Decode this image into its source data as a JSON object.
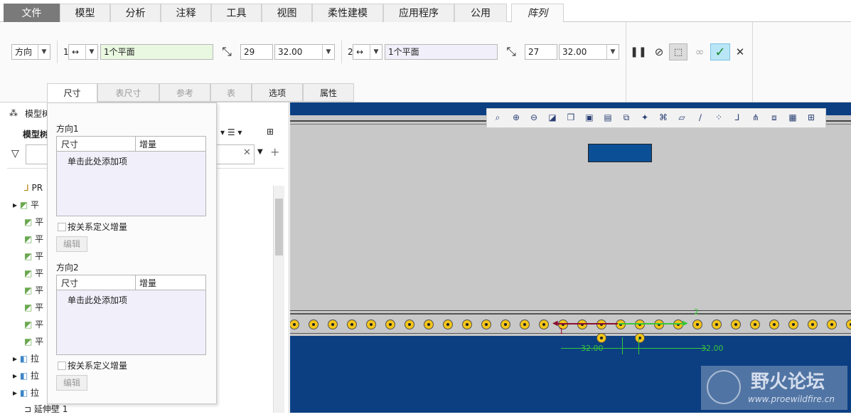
{
  "menu_tabs": [
    "文件",
    "模型",
    "分析",
    "注释",
    "工具",
    "视图",
    "柔性建模",
    "应用程序",
    "公用",
    "阵列"
  ],
  "ribbon": {
    "type_select": "方向",
    "dir1": {
      "index": "1",
      "reference": "1个平面",
      "count": "29",
      "spacing": "32.00"
    },
    "dir2": {
      "index": "2",
      "reference": "1个平面",
      "count": "27",
      "spacing": "32.00"
    },
    "icons": [
      "flip-direction-icon",
      "pause-icon",
      "no-preview-icon",
      "preview-icon",
      "glasses-icon",
      "ok-icon",
      "cancel-icon"
    ]
  },
  "sub_tabs": [
    "尺寸",
    "表尺寸",
    "参考",
    "表",
    "选项",
    "属性"
  ],
  "tree": {
    "header": "模型树",
    "subheader": "模型树",
    "items": [
      "PR",
      "平",
      "平",
      "平",
      "平",
      "平",
      "平",
      "平",
      "平",
      "平",
      "拉",
      "拉",
      "拉",
      "延伸壁 1"
    ]
  },
  "panel": {
    "dir1_title": "方向1",
    "dir2_title": "方向2",
    "col_dim": "尺寸",
    "col_inc": "增量",
    "add_hint": "单击此处添加项",
    "relation_label": "按关系定义增量",
    "edit_label": "编辑"
  },
  "graphics": {
    "dim_left": "32.00",
    "dim_right": "32.00",
    "dir1_mark": "1",
    "dir2_mark": "2",
    "watermark_title": "野火论坛",
    "watermark_url": "www.proewildfire.cn"
  },
  "colors": {
    "accent": "#1e5aa0",
    "model_blue": "#0b3f82",
    "highlight_green": "#e9f8e0",
    "ok_green": "#b9e6f7"
  }
}
